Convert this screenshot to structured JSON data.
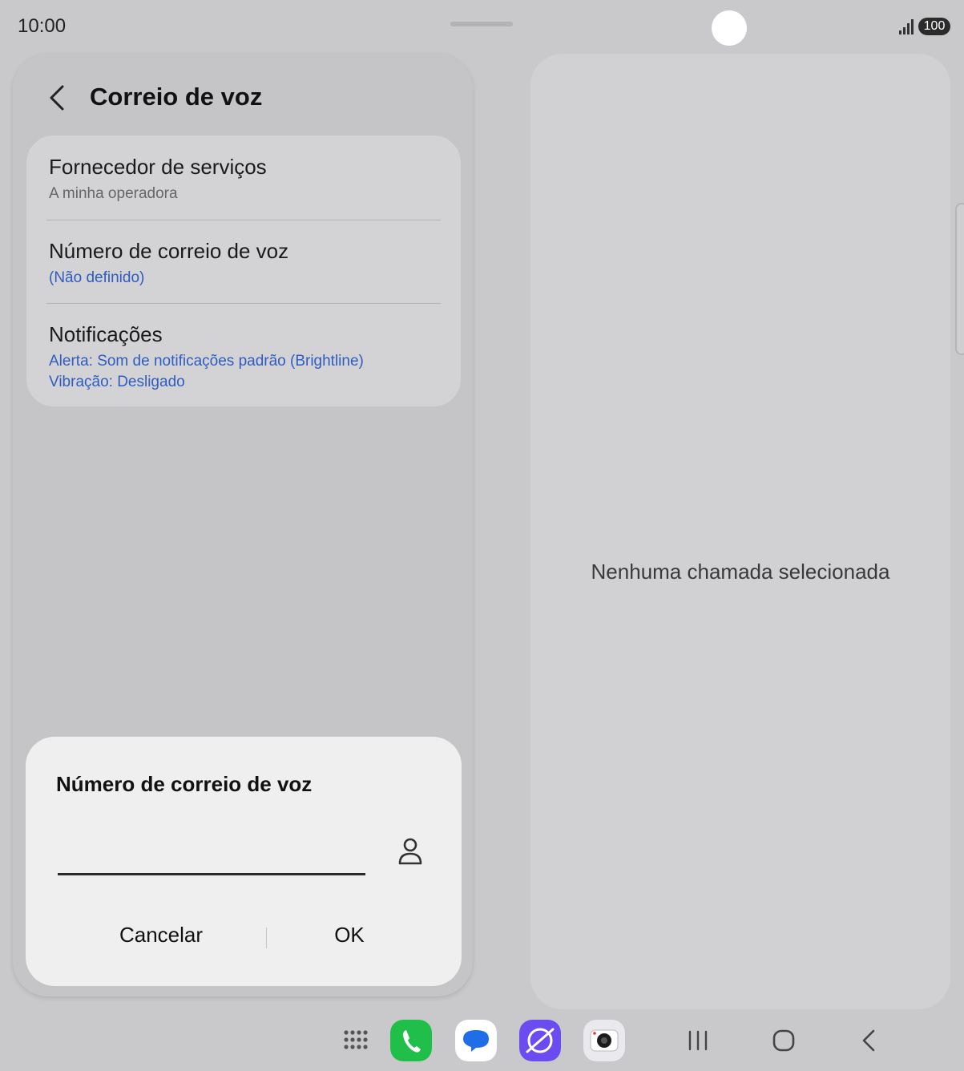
{
  "status": {
    "time": "10:00",
    "battery": "100"
  },
  "header": {
    "title": "Correio de voz"
  },
  "settings": [
    {
      "title": "Fornecedor de serviços",
      "subtitle": "A minha operadora"
    },
    {
      "title": "Número de correio de voz",
      "subtitle": "(Não definido)"
    },
    {
      "title": "Notificações",
      "subtitle_1": "Alerta: Som de notificações padrão (Brightline)",
      "subtitle_2": "Vibração: Desligado"
    }
  ],
  "detail": {
    "empty_message": "Nenhuma chamada selecionada"
  },
  "dialog": {
    "title": "Número de correio de voz",
    "input_value": "",
    "cancel_label": "Cancelar",
    "ok_label": "OK"
  },
  "dock": {
    "icons": [
      "apps-grid-icon",
      "phone-app-icon",
      "messages-app-icon",
      "internet-app-icon",
      "camera-app-icon"
    ],
    "nav": [
      "recents-icon",
      "home-icon",
      "back-icon"
    ]
  },
  "colors": {
    "link_blue": "#2f5cc0",
    "phone_green": "#1fbf4a",
    "messages_blue": "#1f6ee8",
    "internet_purple": "#6a4cf0"
  }
}
